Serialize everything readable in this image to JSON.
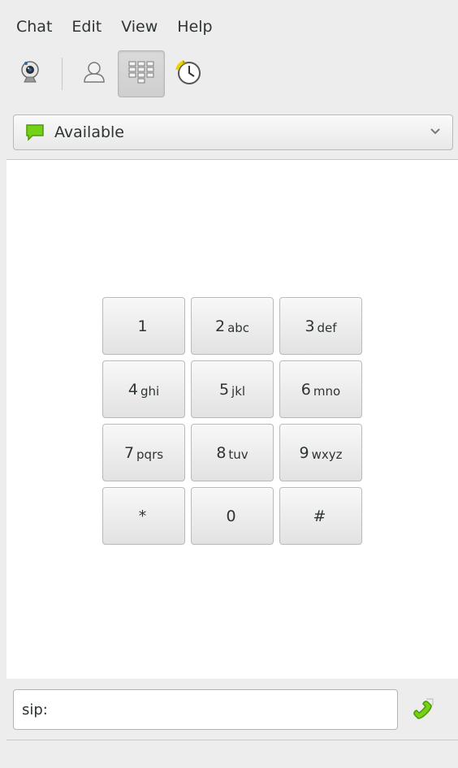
{
  "menubar": {
    "items": [
      "Chat",
      "Edit",
      "View",
      "Help"
    ]
  },
  "toolbar": {
    "buttons": [
      {
        "icon": "webcam-icon"
      },
      {
        "icon": "contact-person-icon"
      },
      {
        "icon": "dialpad-icon",
        "active": true
      },
      {
        "icon": "history-clock-icon"
      }
    ]
  },
  "presence": {
    "label": "Available",
    "icon": "speech-bubble-green-icon",
    "color": "#4e9a06"
  },
  "dialpad": {
    "keys": [
      {
        "num": "1",
        "letters": ""
      },
      {
        "num": "2",
        "letters": "abc"
      },
      {
        "num": "3",
        "letters": "def"
      },
      {
        "num": "4",
        "letters": "ghi"
      },
      {
        "num": "5",
        "letters": "jkl"
      },
      {
        "num": "6",
        "letters": "mno"
      },
      {
        "num": "7",
        "letters": "pqrs"
      },
      {
        "num": "8",
        "letters": "tuv"
      },
      {
        "num": "9",
        "letters": "wxyz"
      },
      {
        "num": "*",
        "letters": ""
      },
      {
        "num": "0",
        "letters": ""
      },
      {
        "num": "#",
        "letters": ""
      }
    ]
  },
  "call": {
    "value": "sip:",
    "icon": "call-phone-icon"
  }
}
